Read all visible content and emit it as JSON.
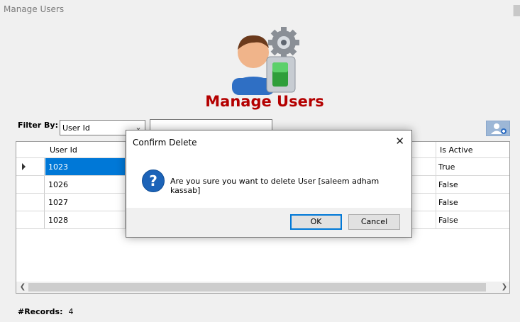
{
  "window": {
    "title": "Manage Users"
  },
  "header": {
    "title": "Manage Users",
    "icon": "users-manage-icon"
  },
  "filter": {
    "label": "Filter By:",
    "selected": "User Id",
    "text_value": ""
  },
  "toolbar": {
    "add_user_icon": "add-user-icon"
  },
  "grid": {
    "columns": [
      "User Id",
      "Is Active"
    ],
    "rows": [
      {
        "user_id": "1023",
        "is_active": "True",
        "selected": true
      },
      {
        "user_id": "1026",
        "is_active": "False"
      },
      {
        "user_id": "1027",
        "is_active": "False"
      },
      {
        "user_id": "1028",
        "is_active": "False"
      }
    ]
  },
  "footer": {
    "records_label": "#Records:",
    "records_count": "4"
  },
  "dialog": {
    "title": "Confirm Delete",
    "message": "Are you sure you want to delete User [saleem adham kassab]",
    "ok_label": "OK",
    "cancel_label": "Cancel",
    "icon": "question-icon",
    "accent": "#0078d7"
  },
  "colors": {
    "heading": "#b40000",
    "selection": "#0078d7"
  }
}
